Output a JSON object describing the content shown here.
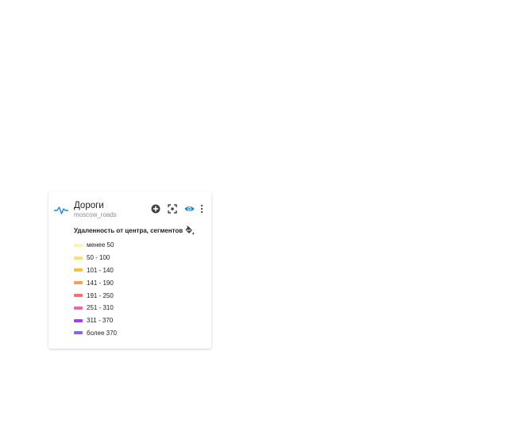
{
  "layer": {
    "title": "Дороги",
    "subtitle": "moscow_roads",
    "legend_title": "Удаленность от центра, сегментов",
    "visible": true,
    "accent_color": "#1e88e5",
    "icons": {
      "layer_type": "line-layer-icon",
      "add": "add-circle-icon",
      "zoom_to": "fullscreen-focus-icon",
      "visibility": "eye-icon",
      "menu": "more-vertical-icon",
      "style": "paint-bucket-icon"
    },
    "legend_items": [
      {
        "label": "менее 50",
        "color": "#fff3a6"
      },
      {
        "label": "50 - 100",
        "color": "#ffe064"
      },
      {
        "label": "101 - 140",
        "color": "#ffbc3b"
      },
      {
        "label": "141 - 190",
        "color": "#ff9a4f"
      },
      {
        "label": "191 - 250",
        "color": "#ff6c6c"
      },
      {
        "label": "251 - 310",
        "color": "#f55fb4"
      },
      {
        "label": "311 - 370",
        "color": "#a93cf0"
      },
      {
        "label": "более 370",
        "color": "#8a63f5"
      }
    ]
  }
}
